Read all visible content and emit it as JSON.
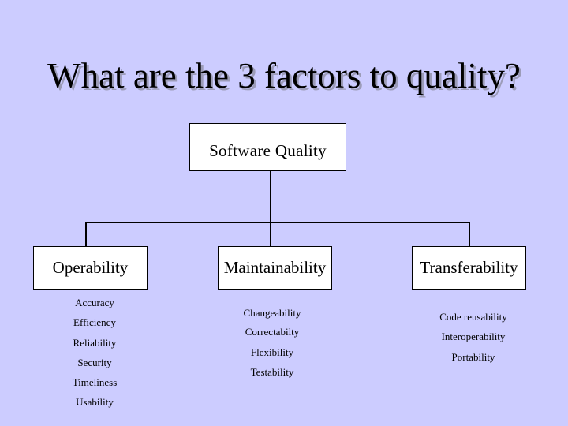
{
  "slide": {
    "title": "What are the 3 factors to quality?",
    "background_color": "#CCCCFF"
  },
  "diagram": {
    "root": {
      "label": "Software Quality"
    },
    "factors": [
      {
        "label": "Operability",
        "items": [
          "Accuracy",
          "Efficiency",
          "Reliability",
          "Security",
          "Timeliness",
          "Usability"
        ]
      },
      {
        "label": "Maintainability",
        "items": [
          "Changeability",
          "Correctabilty",
          "Flexibility",
          "Testability"
        ]
      },
      {
        "label": "Transferability",
        "items": [
          "Code reusability",
          "Interoperability",
          "Portability"
        ]
      }
    ]
  }
}
